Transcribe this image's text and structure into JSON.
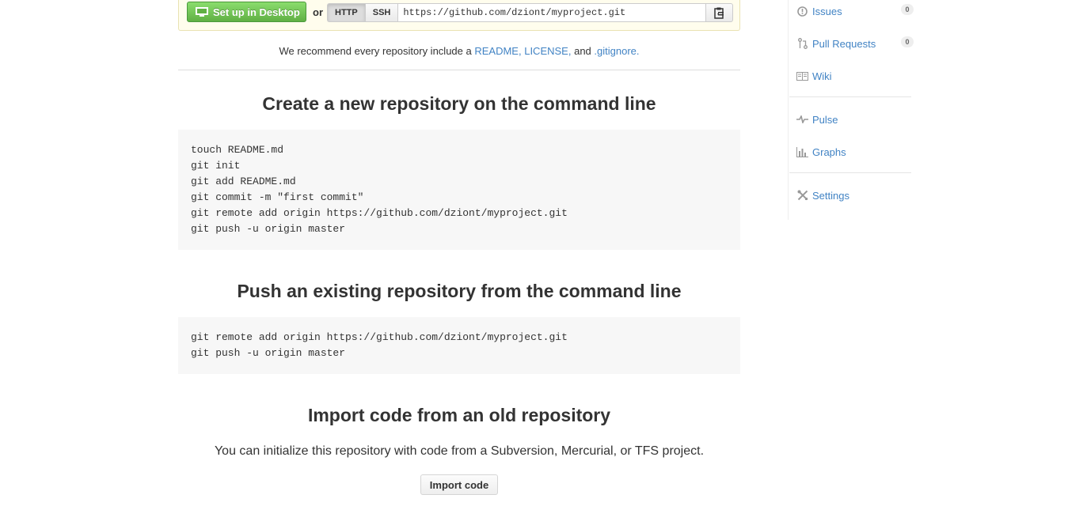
{
  "quick_setup": {
    "desktop_button": "Set up in Desktop",
    "or_label": "or",
    "protocols": [
      "HTTP",
      "SSH"
    ],
    "clone_url": "https://github.com/dziont/myproject.git",
    "clipboard_icon": "clipboard-icon"
  },
  "recommend": {
    "prefix": "We recommend every repository include a",
    "readme": "README,",
    "license": "LICENSE,",
    "and": "and",
    "gitignore": ".gitignore."
  },
  "sections": {
    "new_repo": {
      "title": "Create a new repository on the command line",
      "code": "touch README.md\ngit init\ngit add README.md\ngit commit -m \"first commit\"\ngit remote add origin https://github.com/dziont/myproject.git\ngit push -u origin master"
    },
    "push_existing": {
      "title": "Push an existing repository from the command line",
      "code": "git remote add origin https://github.com/dziont/myproject.git\ngit push -u origin master"
    },
    "import": {
      "title": "Import code from an old repository",
      "description": "You can initialize this repository with code from a Subversion, Mercurial, or TFS project.",
      "button": "Import code"
    }
  },
  "sidebar": {
    "issues": {
      "label": "Issues",
      "count": "0",
      "icon": "issue-icon"
    },
    "pull_requests": {
      "label": "Pull Requests",
      "count": "0",
      "icon": "pull-request-icon"
    },
    "wiki": {
      "label": "Wiki",
      "icon": "book-icon"
    },
    "pulse": {
      "label": "Pulse",
      "icon": "pulse-icon"
    },
    "graphs": {
      "label": "Graphs",
      "icon": "graph-icon"
    },
    "settings": {
      "label": "Settings",
      "icon": "tools-icon"
    }
  },
  "colors": {
    "link": "#4183c4",
    "green_button": "#60b044",
    "code_bg": "#f7f7f7"
  }
}
